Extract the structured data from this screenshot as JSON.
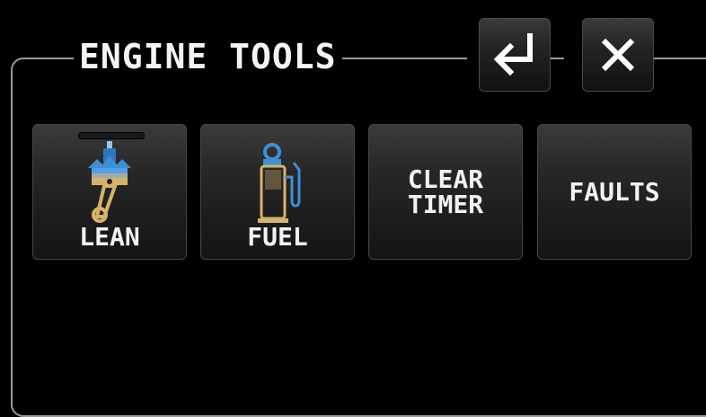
{
  "panel": {
    "title": "ENGINE TOOLS"
  },
  "header_buttons": [
    {
      "name": "enter",
      "icon": "return-arrow-icon"
    },
    {
      "name": "close",
      "icon": "close-x-icon"
    }
  ],
  "tiles": [
    {
      "label": "LEAN",
      "icon": "piston-lean-icon"
    },
    {
      "label": "FUEL",
      "icon": "fuel-pump-icon"
    },
    {
      "label_line1": "CLEAR",
      "label_line2": "TIMER"
    },
    {
      "label": "FAULTS"
    }
  ],
  "colors": {
    "background": "#000000",
    "border": "#9a9a9a",
    "icon_blue": "#3d8fd6",
    "icon_gold": "#d6b36a"
  }
}
